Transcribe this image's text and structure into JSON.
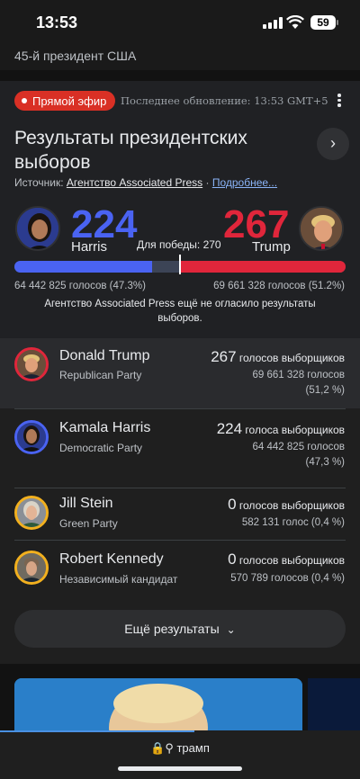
{
  "status_bar": {
    "time": "13:53",
    "battery": "59"
  },
  "header": {
    "subtitle": "45-й президент США"
  },
  "card": {
    "live_label": "Прямой эфир",
    "updated": "Последнее обновление: 13:53 GMT+5",
    "title": "Результаты президентских выборов",
    "source_prefix": "Источник: ",
    "source_name": "Агентство Associated Press",
    "source_sep": " · ",
    "more_link": "Подробнее...",
    "harris": {
      "electoral": "224",
      "name": "Harris",
      "popular": "64 442 825 голосов (47.3%)"
    },
    "trump": {
      "electoral": "267",
      "name": "Trump",
      "popular": "69 661 328 голосов (51.2%)"
    },
    "to_win": "Для победы: 270",
    "bar": {
      "total_electoral": 538,
      "harris_electoral": 224,
      "trump_electoral": 267,
      "needed": 270
    },
    "ap_note": "Агентство Associated Press ещё не огласило результаты выборов.",
    "colors": {
      "dem": "#4a63f2",
      "rep": "#e0263b",
      "live": "#d93025"
    }
  },
  "candidates": [
    {
      "name": "Donald Trump",
      "party": "Republican Party",
      "electoral_num": "267",
      "electoral_label": " голосов выборщиков",
      "line1": "69 661 328 голосов",
      "line2": "(51,2 %)",
      "ring": "#e0263b"
    },
    {
      "name": "Kamala Harris",
      "party": "Democratic Party",
      "electoral_num": "224",
      "electoral_label": " голоса выборщиков",
      "line1": "64 442 825 голосов",
      "line2": "(47,3 %)",
      "ring": "#4a63f2"
    },
    {
      "name": "Jill Stein",
      "party": "Green Party",
      "electoral_num": "0",
      "electoral_label": " голосов выборщиков",
      "line1": "582 131 голос (0,4 %)",
      "line2": "",
      "ring": "#f2b01e"
    },
    {
      "name": "Robert Kennedy",
      "party": "Независимый кандидат",
      "electoral_num": "0",
      "electoral_label": " голосов выборщиков",
      "line1": "570 789 голосов (0,4 %)",
      "line2": "",
      "ring": "#f2b01e"
    }
  ],
  "more_results": "Ещё результаты",
  "url_bar": {
    "query": "трамп",
    "icons": [
      "lock-icon",
      "search-icon"
    ]
  }
}
